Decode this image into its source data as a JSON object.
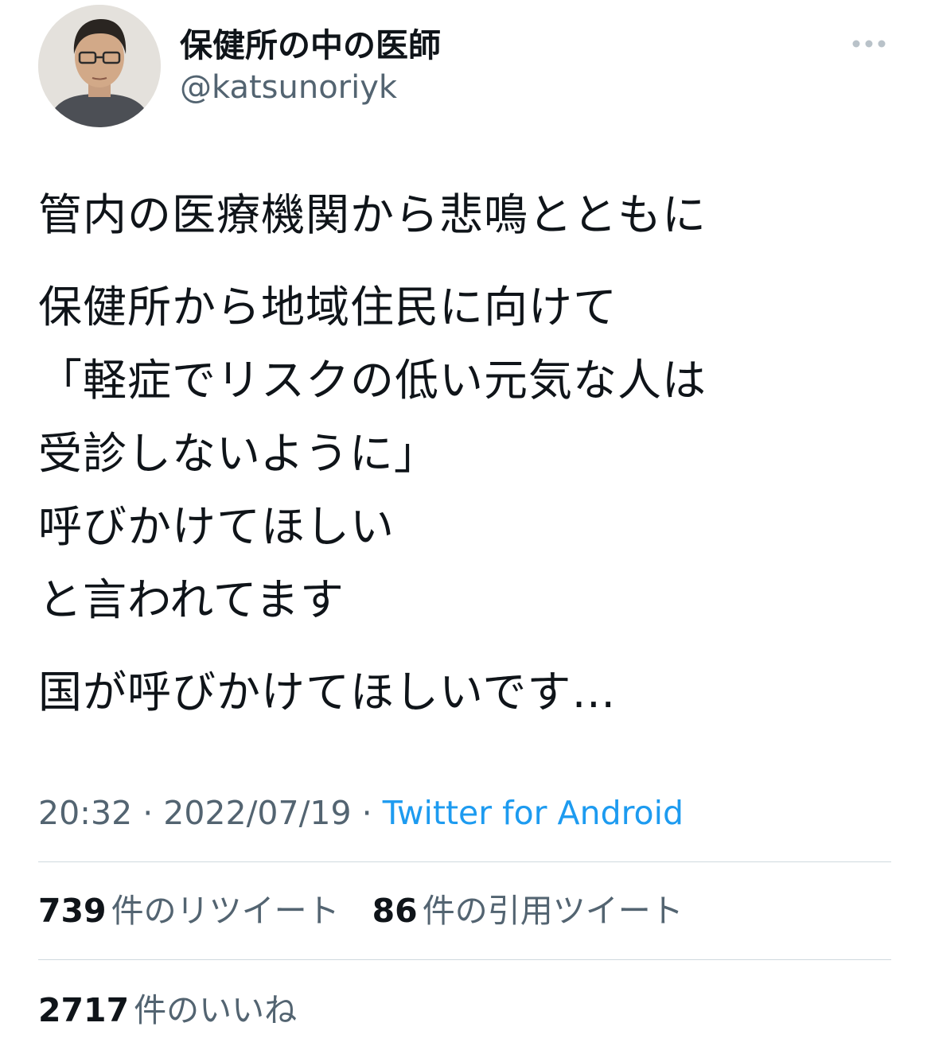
{
  "author": {
    "display_name": "保健所の中の医師",
    "handle": "@katsunoriyk"
  },
  "tweet": {
    "paragraphs": [
      [
        "管内の医療機関から悲鳴とともに"
      ],
      [
        "保健所から地域住民に向けて",
        "「軽症でリスクの低い元気な人は",
        "受診しないように」",
        "呼びかけてほしい",
        "と言われてます"
      ],
      [
        "国が呼びかけてほしいです…"
      ]
    ]
  },
  "meta": {
    "time": "20:32",
    "separator": " · ",
    "date": "2022/07/19",
    "source": "Twitter for Android"
  },
  "stats": {
    "retweets": {
      "count": "739",
      "label": "件のリツイート"
    },
    "quotes": {
      "count": "86",
      "label": "件の引用ツイート"
    },
    "likes": {
      "count": "2717",
      "label": "件のいいね"
    }
  },
  "icons": {
    "more": "more-options-icon",
    "avatar": "profile-photo"
  },
  "colors": {
    "text": "#0f1419",
    "secondary": "#536471",
    "link": "#1d9bf0",
    "divider": "#cfd9de"
  }
}
